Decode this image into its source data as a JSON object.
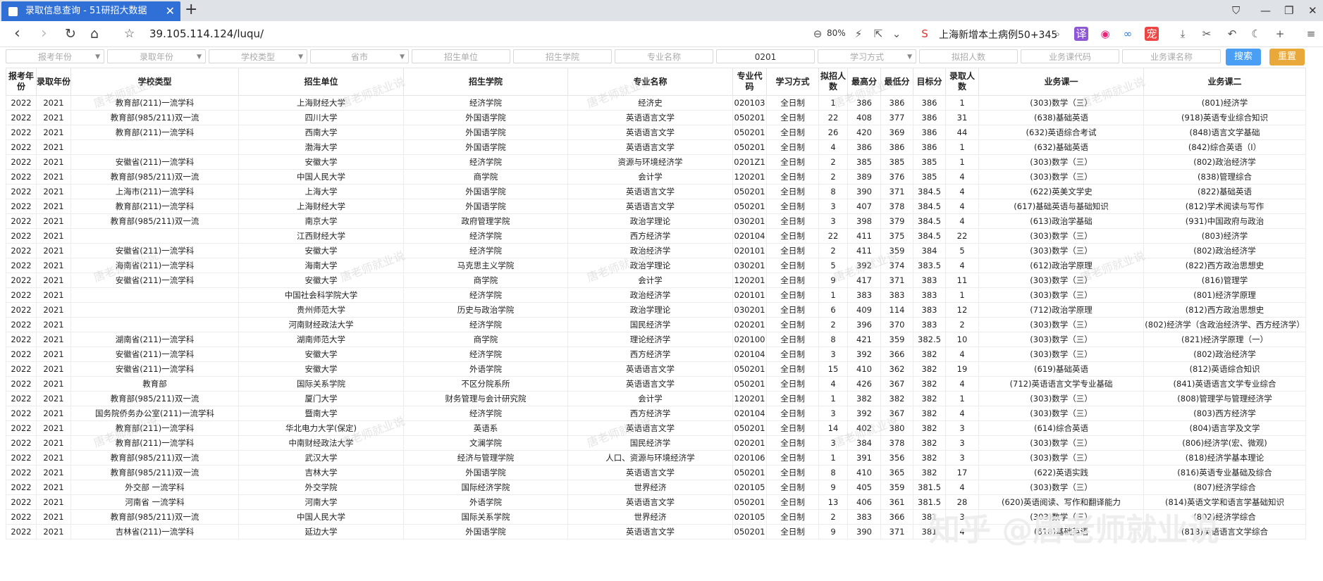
{
  "browser": {
    "tab_title": "录取信息查询 - 51研招大数据",
    "url": "39.105.114.124/luqu/",
    "zoom": "80%",
    "search_text": "上海新增本土病例50+345"
  },
  "filters": {
    "selects": [
      "报考年份",
      "录取年份",
      "学校类型",
      "省市"
    ],
    "inputs": [
      "招生单位",
      "招生学院",
      "专业名称"
    ],
    "code_value": "0201",
    "selects2": [
      "学习方式"
    ],
    "inputs2": [
      "拟招人数",
      "业务课代码",
      "业务课名称"
    ],
    "search_label": "搜索",
    "reset_label": "重置",
    "search_color": "#4a9ff5",
    "reset_color": "#e8a83a"
  },
  "table": {
    "headers": [
      "报考年份",
      "录取年份",
      "学校类型",
      "招生单位",
      "招生学院",
      "专业名称",
      "专业代码",
      "学习方式",
      "拟招人数",
      "最高分",
      "最低分",
      "目标分",
      "录取人数",
      "业务课一",
      "业务课二"
    ],
    "rows": [
      [
        "2022",
        "2021",
        "教育部(211)一流学科",
        "上海财经大学",
        "经济学院",
        "经济史",
        "020103",
        "全日制",
        "1",
        "386",
        "386",
        "386",
        "1",
        "(303)数学（三）",
        "(801)经济学"
      ],
      [
        "2022",
        "2021",
        "教育部(985/211)双一流",
        "四川大学",
        "外国语学院",
        "英语语言文学",
        "050201",
        "全日制",
        "22",
        "408",
        "377",
        "386",
        "31",
        "(638)基础英语",
        "(918)英语专业综合知识"
      ],
      [
        "2022",
        "2021",
        "教育部(211)一流学科",
        "西南大学",
        "外国语学院",
        "英语语言文学",
        "050201",
        "全日制",
        "26",
        "420",
        "369",
        "386",
        "44",
        "(632)英语综合考试",
        "(848)语言文学基础"
      ],
      [
        "2022",
        "2021",
        "",
        "渤海大学",
        "外国语学院",
        "英语语言文学",
        "050201",
        "全日制",
        "4",
        "386",
        "386",
        "386",
        "1",
        "(632)基础英语",
        "(842)综合英语（Ⅰ）"
      ],
      [
        "2022",
        "2021",
        "安徽省(211)一流学科",
        "安徽大学",
        "经济学院",
        "资源与环境经济学",
        "0201Z1",
        "全日制",
        "2",
        "385",
        "385",
        "385",
        "1",
        "(303)数学（三）",
        "(802)政治经济学"
      ],
      [
        "2022",
        "2021",
        "教育部(985/211)双一流",
        "中国人民大学",
        "商学院",
        "会计学",
        "120201",
        "全日制",
        "2",
        "389",
        "376",
        "385",
        "4",
        "(303)数学（三）",
        "(838)管理综合"
      ],
      [
        "2022",
        "2021",
        "上海市(211)一流学科",
        "上海大学",
        "外国语学院",
        "英语语言文学",
        "050201",
        "全日制",
        "8",
        "390",
        "371",
        "384.5",
        "4",
        "(622)英美文学史",
        "(822)基础英语"
      ],
      [
        "2022",
        "2021",
        "教育部(211)一流学科",
        "上海财经大学",
        "外国语学院",
        "英语语言文学",
        "050201",
        "全日制",
        "3",
        "407",
        "378",
        "384.5",
        "4",
        "(617)基础英语与基础知识",
        "(812)学术阅读与写作"
      ],
      [
        "2022",
        "2021",
        "教育部(985/211)双一流",
        "南京大学",
        "政府管理学院",
        "政治学理论",
        "030201",
        "全日制",
        "3",
        "398",
        "379",
        "384.5",
        "4",
        "(613)政治学基础",
        "(931)中国政府与政治"
      ],
      [
        "2022",
        "2021",
        "",
        "江西财经大学",
        "经济学院",
        "西方经济学",
        "020104",
        "全日制",
        "22",
        "411",
        "375",
        "384.5",
        "22",
        "(303)数学（三）",
        "(803)经济学"
      ],
      [
        "2022",
        "2021",
        "安徽省(211)一流学科",
        "安徽大学",
        "经济学院",
        "政治经济学",
        "020101",
        "全日制",
        "2",
        "411",
        "359",
        "384",
        "5",
        "(303)数学（三）",
        "(802)政治经济学"
      ],
      [
        "2022",
        "2021",
        "海南省(211)一流学科",
        "海南大学",
        "马克思主义学院",
        "政治学理论",
        "030201",
        "全日制",
        "5",
        "392",
        "374",
        "383.5",
        "4",
        "(612)政治学原理",
        "(822)西方政治思想史"
      ],
      [
        "2022",
        "2021",
        "安徽省(211)一流学科",
        "安徽大学",
        "商学院",
        "会计学",
        "120201",
        "全日制",
        "9",
        "417",
        "371",
        "383",
        "11",
        "(303)数学（三）",
        "(816)管理学"
      ],
      [
        "2022",
        "2021",
        "",
        "中国社会科学院大学",
        "经济学院",
        "政治经济学",
        "020101",
        "全日制",
        "1",
        "383",
        "383",
        "383",
        "1",
        "(303)数学（三）",
        "(801)经济学原理"
      ],
      [
        "2022",
        "2021",
        "",
        "贵州师范大学",
        "历史与政治学院",
        "政治学理论",
        "030201",
        "全日制",
        "6",
        "409",
        "114",
        "383",
        "12",
        "(712)政治学原理",
        "(812)西方政治思想史"
      ],
      [
        "2022",
        "2021",
        "",
        "河南财经政法大学",
        "经济学院",
        "国民经济学",
        "020201",
        "全日制",
        "2",
        "396",
        "370",
        "383",
        "2",
        "(303)数学（三）",
        "(802)经济学（含政治经济学、西方经济学）"
      ],
      [
        "2022",
        "2021",
        "湖南省(211)一流学科",
        "湖南师范大学",
        "商学院",
        "理论经济学",
        "020100",
        "全日制",
        "8",
        "421",
        "359",
        "382.5",
        "10",
        "(303)数学（三）",
        "(821)经济学原理（一）"
      ],
      [
        "2022",
        "2021",
        "安徽省(211)一流学科",
        "安徽大学",
        "经济学院",
        "西方经济学",
        "020104",
        "全日制",
        "3",
        "392",
        "366",
        "382",
        "4",
        "(303)数学（三）",
        "(802)政治经济学"
      ],
      [
        "2022",
        "2021",
        "安徽省(211)一流学科",
        "安徽大学",
        "外语学院",
        "英语语言文学",
        "050201",
        "全日制",
        "15",
        "410",
        "362",
        "382",
        "19",
        "(619)基础英语",
        "(812)英语综合知识"
      ],
      [
        "2022",
        "2021",
        "教育部",
        "国际关系学院",
        "不区分院系所",
        "英语语言文学",
        "050201",
        "全日制",
        "4",
        "426",
        "367",
        "382",
        "4",
        "(712)英语语言文学专业基础",
        "(841)英语语言文学专业综合"
      ],
      [
        "2022",
        "2021",
        "教育部(985/211)双一流",
        "厦门大学",
        "财务管理与会计研究院",
        "会计学",
        "120201",
        "全日制",
        "1",
        "382",
        "382",
        "382",
        "1",
        "(303)数学（三）",
        "(808)管理学与管理经济学"
      ],
      [
        "2022",
        "2021",
        "国务院侨务办公室(211)一流学科",
        "暨南大学",
        "经济学院",
        "西方经济学",
        "020104",
        "全日制",
        "3",
        "392",
        "367",
        "382",
        "4",
        "(303)数学（三）",
        "(803)西方经济学"
      ],
      [
        "2022",
        "2021",
        "教育部(211)一流学科",
        "华北电力大学(保定)",
        "英语系",
        "英语语言文学",
        "050201",
        "全日制",
        "14",
        "402",
        "380",
        "382",
        "3",
        "(614)综合英语",
        "(804)语言学及文学"
      ],
      [
        "2022",
        "2021",
        "教育部(211)一流学科",
        "中南财经政法大学",
        "文澜学院",
        "国民经济学",
        "020201",
        "全日制",
        "3",
        "384",
        "378",
        "382",
        "3",
        "(303)数学（三）",
        "(806)经济学(宏、微观)"
      ],
      [
        "2022",
        "2021",
        "教育部(985/211)双一流",
        "武汉大学",
        "经济与管理学院",
        "人口、资源与环境经济学",
        "020106",
        "全日制",
        "1",
        "391",
        "356",
        "382",
        "3",
        "(303)数学（三）",
        "(818)经济学基本理论"
      ],
      [
        "2022",
        "2021",
        "教育部(985/211)双一流",
        "吉林大学",
        "外国语学院",
        "英语语言文学",
        "050201",
        "全日制",
        "8",
        "410",
        "365",
        "382",
        "17",
        "(622)英语实践",
        "(816)英语专业基础及综合"
      ],
      [
        "2022",
        "2021",
        "外交部 一流学科",
        "外交学院",
        "国际经济学院",
        "世界经济",
        "020105",
        "全日制",
        "9",
        "405",
        "359",
        "381.5",
        "4",
        "(303)数学（三）",
        "(807)经济学综合"
      ],
      [
        "2022",
        "2021",
        "河南省 一流学科",
        "河南大学",
        "外语学院",
        "英语语言文学",
        "050201",
        "全日制",
        "13",
        "406",
        "361",
        "381.5",
        "28",
        "(620)英语阅读、写作和翻译能力",
        "(814)英语文学和语言学基础知识"
      ],
      [
        "2022",
        "2021",
        "教育部(985/211)双一流",
        "中国人民大学",
        "国际关系学院",
        "世界经济",
        "020105",
        "全日制",
        "2",
        "383",
        "366",
        "381",
        "3",
        "(303)数学（三）",
        "(802)经济学综合"
      ],
      [
        "2022",
        "2021",
        "吉林省(211)一流学科",
        "延边大学",
        "外国语学院",
        "英语语言文学",
        "050201",
        "全日制",
        "9",
        "390",
        "371",
        "381",
        "4",
        "(618)基础英语",
        "(818)英语语言文学综合"
      ]
    ]
  },
  "watermark": "唐老师就业说",
  "zhihu_watermark": "知乎 @唐老师就业说"
}
